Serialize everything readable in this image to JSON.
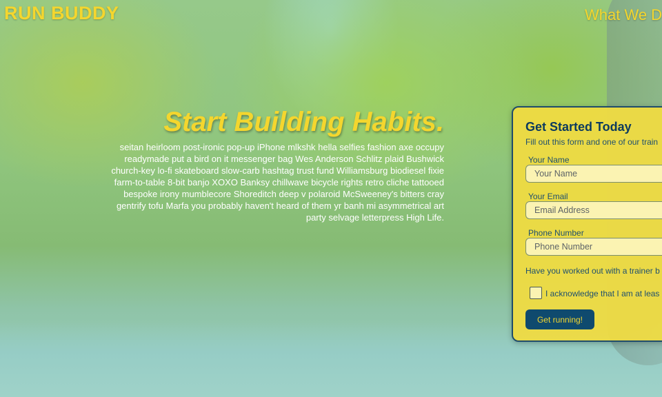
{
  "header": {
    "brand": "RUN BUDDY",
    "nav": [
      {
        "label": "What We D"
      }
    ]
  },
  "hero": {
    "title": "Start Building Habits.",
    "body": "seitan heirloom post-ironic pop-up iPhone mlkshk hella selfies fashion axe occupy readymade put a bird on it messenger bag Wes Anderson Schlitz plaid Bushwick church-key lo-fi skateboard slow-carb hashtag trust fund Williamsburg biodiesel fixie farm-to-table 8-bit banjo XOXO Banksy chillwave bicycle rights retro cliche tattooed bespoke irony mumblecore Shoreditch deep v polaroid McSweeney's bitters cray gentrify tofu Marfa you probably haven't heard of them yr banh mi asymmetrical art party selvage letterpress High Life."
  },
  "form": {
    "title": "Get Started Today",
    "intro": "Fill out this form and one of our train",
    "fields": [
      {
        "label": "Your Name",
        "placeholder": "Your Name"
      },
      {
        "label": "Your Email",
        "placeholder": "Email Address"
      },
      {
        "label": "Phone Number",
        "placeholder": "Phone Number"
      }
    ],
    "question": "Have you worked out with a trainer b",
    "acknowledge": "I acknowledge that I am at leas",
    "acknowledge_checked": false,
    "submit_label": "Get running!"
  },
  "colors": {
    "accent_yellow": "#f4d62e",
    "navy": "#0f4a6e",
    "form_bg": "#efdb42"
  }
}
